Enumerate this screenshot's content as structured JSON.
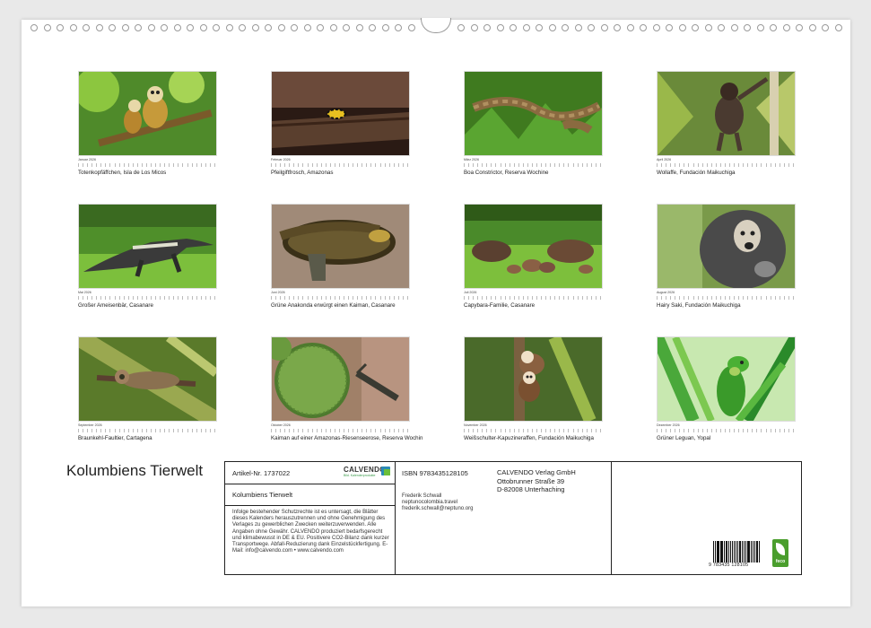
{
  "calendar": {
    "title": "Kolumbiens Tierwelt",
    "months": [
      {
        "name": "Januar 2026",
        "caption": "Totenkopfäffchen, Isla de Los Micos",
        "scene": "monkeys"
      },
      {
        "name": "Februar 2026",
        "caption": "Pfeilgiftfrosch, Amazonas",
        "scene": "frog"
      },
      {
        "name": "März 2026",
        "caption": "Boa Constrictor, Reserva Wochine",
        "scene": "boa"
      },
      {
        "name": "April 2026",
        "caption": "Wollaffe, Fundación Maikuchiga",
        "scene": "woollymonkey"
      },
      {
        "name": "Mai 2026",
        "caption": "Großer Ameisenbär, Casanare",
        "scene": "anteater"
      },
      {
        "name": "Juni 2026",
        "caption": "Grüne Anakonda erwürgt einen Kaiman, Casanare",
        "scene": "anaconda"
      },
      {
        "name": "Juli 2026",
        "caption": "Capybara-Familie, Casanare",
        "scene": "capybara"
      },
      {
        "name": "August 2026",
        "caption": "Hairy Saki, Fundación Maikuchiga",
        "scene": "saki"
      },
      {
        "name": "September 2026",
        "caption": "Braunkehl-Faultier, Cartagena",
        "scene": "sloth"
      },
      {
        "name": "Oktober 2026",
        "caption": "Kaiman auf einer Amazonas-Riesenseerose, Reserva Wochin",
        "scene": "lily"
      },
      {
        "name": "November 2026",
        "caption": "Weißschulter-Kapuzineraffen, Fundación Maikuchiga",
        "scene": "capuchin"
      },
      {
        "name": "Dezember 2026",
        "caption": "Grüner Leguan, Yopal",
        "scene": "iguana"
      }
    ]
  },
  "info": {
    "article": "Artikel-Nr. 1737022",
    "product_title": "Kolumbiens Tierwelt",
    "logo_text": "CALVENDO",
    "logo_sub": "Bild. Kalenderprodukte",
    "isbn": "ISBN 9783435128105",
    "publisher_lines": [
      "CALVENDO Verlag GmbH",
      "Ottobrunner Straße 39",
      "D-82008 Unterhaching"
    ],
    "author_lines": [
      "Frederik Schwall",
      "neptunocolombia.travel",
      "frederik.schwall@neptuno.org"
    ],
    "legal_text": "Infolge bestehender Schutzrechte ist es untersagt, die Blätter dieses Kalenders herauszutrennen und ohne Genehmigung des Verlages zu gewerblichen Zwecken weiterzuverwenden. Alle Angaben ohne Gewähr. CALVENDO produziert bedarfsgerecht und klimabewusst in DE & EU. Positivere CO2-Bilanz dank kurzer Transportwege. Abfall-Reduzierung dank Einzelstückfertigung. E-Mail: info@calvendo.com • www.calvendo.com",
    "barcode_number": "9 783435 128105",
    "eco_label": "feco"
  },
  "colors": {
    "page_bg": "#e9e9e9",
    "sheet": "#ffffff",
    "border": "#222222",
    "eco_green": "#4a9e2d"
  }
}
